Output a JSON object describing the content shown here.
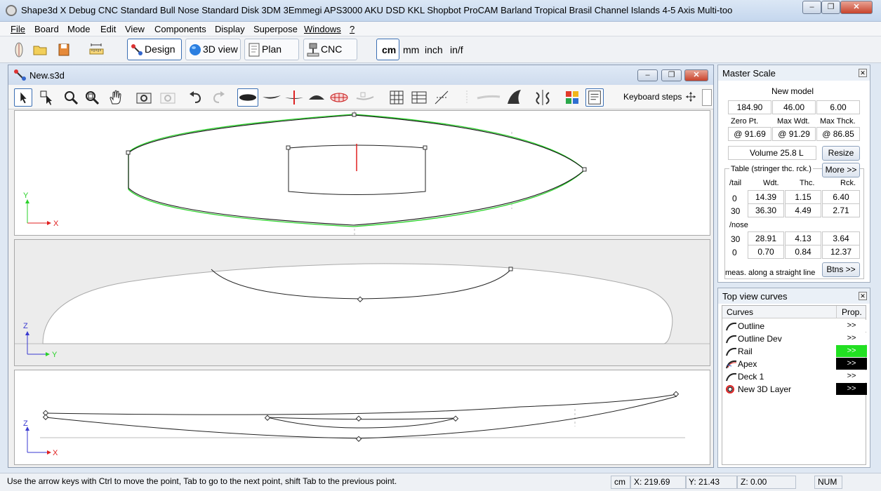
{
  "window": {
    "title": "Shape3d X Debug CNC  Standard Bull Nose Standard Disk 3DM 3Emmegi APS3000 AKU DSD KKL Shopbot ProCAM Barland Tropical Brasil Channel Islands 4-5 Axis Multi-too",
    "minimize": "–",
    "restore": "❐",
    "close": "✕"
  },
  "menu": [
    "File",
    "Board",
    "Mode",
    "Edit",
    "View",
    "Components",
    "Display",
    "Superpose",
    "Windows",
    "?"
  ],
  "toolbar": {
    "design": "Design",
    "view3d": "3D view",
    "plan": "Plan",
    "cnc": "CNC",
    "units": [
      "cm",
      "mm",
      "inch",
      "in/f"
    ]
  },
  "document": {
    "title": "New.s3d",
    "keyboard_steps": "Keyboard steps"
  },
  "views": {
    "top": {
      "axis_v": "Y",
      "axis_h": "X"
    },
    "front": {
      "axis_v": "Z",
      "axis_h": "Y"
    },
    "side": {
      "axis_v": "Z",
      "axis_h": "X"
    }
  },
  "master_scale": {
    "title": "Master Scale",
    "model_name": "New model",
    "dims": [
      "184.90",
      "46.00",
      "6.00"
    ],
    "headers": [
      "Zero Pt.",
      "Max Wdt.",
      "Max Thck."
    ],
    "positions": [
      "@ 91.69",
      "@ 91.29",
      "@ 86.85"
    ],
    "volume": "Volume  25.8 L",
    "resize": "Resize",
    "table_label": "Table (stringer thc. rck.)",
    "more": "More >>",
    "tail_label": "/tail",
    "col_headers": [
      "Wdt.",
      "Thc.",
      "Rck."
    ],
    "tail_rows": [
      {
        "pos": "0",
        "vals": [
          "14.39",
          "1.15",
          "6.40"
        ]
      },
      {
        "pos": "30",
        "vals": [
          "36.30",
          "4.49",
          "2.71"
        ]
      }
    ],
    "nose_label": "/nose",
    "nose_rows": [
      {
        "pos": "30",
        "vals": [
          "28.91",
          "4.13",
          "3.64"
        ]
      },
      {
        "pos": "0",
        "vals": [
          "0.70",
          "0.84",
          "12.37"
        ]
      }
    ],
    "meas_note": "meas. along a straight line",
    "btns": "Btns >>"
  },
  "top_curves": {
    "title": "Top view curves",
    "col_curves": "Curves",
    "col_prop": "Prop.",
    "items": [
      {
        "label": "Outline",
        "prop": ">>",
        "bg": "#ffffff",
        "fg": "#000000"
      },
      {
        "label": "Outline Dev",
        "prop": ">>",
        "bg": "#ffffff",
        "fg": "#000000"
      },
      {
        "label": "Rail",
        "prop": ">>",
        "bg": "#22e022",
        "fg": "#ffffff"
      },
      {
        "label": "Apex",
        "prop": ">>",
        "bg": "#000000",
        "fg": "#ffffff"
      },
      {
        "label": "Deck 1",
        "prop": ">>",
        "bg": "#ffffff",
        "fg": "#000000"
      },
      {
        "label": "New 3D Layer",
        "prop": ">>",
        "bg": "#000000",
        "fg": "#ffffff"
      }
    ]
  },
  "status": {
    "message": "Use the arrow keys with Ctrl to move the point, Tab to go to the next point, shift Tab to the previous point.",
    "unit": "cm",
    "x": "X: 219.69",
    "y": "Y: 21.43",
    "z": "Z: 0.00",
    "num": "NUM"
  }
}
